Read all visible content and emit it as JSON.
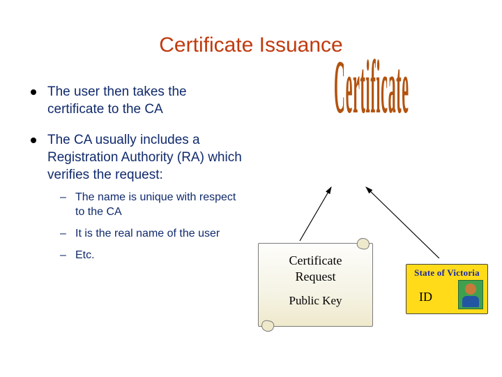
{
  "title": "Certificate Issuance",
  "bullets": {
    "b1": "The user then takes the certificate to the CA",
    "b2": "The CA usually includes a Registration Authority (RA) which verifies the request:",
    "sub": {
      "s1": "The name is unique with respect to the CA",
      "s2": "It is the real name of the user",
      "s3": "Etc."
    }
  },
  "graphic": {
    "certificate_word": "Certificate",
    "scroll_line1": "Certificate",
    "scroll_line2": "Request",
    "scroll_line3": "Public Key",
    "id_banner": "State of Victoria",
    "id_label": "ID"
  }
}
